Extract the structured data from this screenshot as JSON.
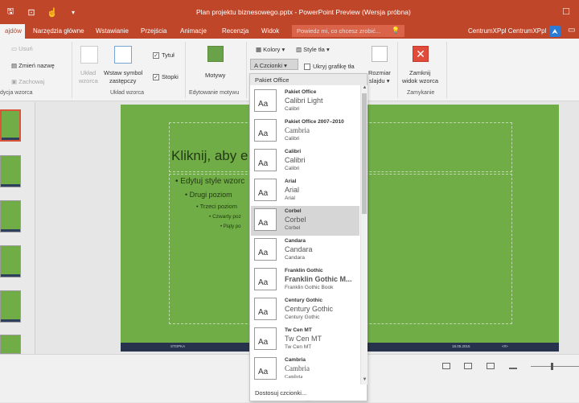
{
  "titlebar": {
    "title": "Plan projektu biznesowego.pptx - PowerPoint Preview (Wersja próbna)",
    "qat_icons": [
      "save-icon",
      "present-from-start-icon",
      "touch-mode-icon",
      "customize-qat-icon"
    ],
    "window_controls": "□"
  },
  "tabs": [
    {
      "label": "ajdów",
      "active": true
    },
    {
      "label": "Narzędzia główne"
    },
    {
      "label": "Wstawianie"
    },
    {
      "label": "Przejścia"
    },
    {
      "label": "Animacje"
    },
    {
      "label": "Recenzja"
    },
    {
      "label": "Widok"
    }
  ],
  "tellme": {
    "placeholder": "Powiedz mi, co chcesz zrobić..."
  },
  "user": {
    "name": "CentrumXPpl CentrumXPpl"
  },
  "ribbon": {
    "usun": "Usuń",
    "zmien_nazwe": "Zmień nazwę",
    "zachowaj": "Zachowaj",
    "edycja_wzorca": "dycja wzorca",
    "uklad_wzorca_btn": [
      "Układ",
      "wzorca"
    ],
    "wstaw_symbol": [
      "Wstaw symbol",
      "zastępczy"
    ],
    "tytul": "Tytuł",
    "stopki": "Stopki",
    "uklad_wzorca_group": "Układ wzorca",
    "motywy": "Motywy",
    "edytowanie_motywu": "Edytowanie motywu",
    "kolory": "Kolory",
    "czcionki": "Czcionki",
    "style_tla": "Style tła",
    "ukryj_grafike": "Ukryj grafikę tła",
    "rozmiar_slajdu": [
      "Rozmiar",
      "slajdu"
    ],
    "zamknij": [
      "Zamknij",
      "widok wzorca"
    ],
    "zamykanie": "Zamykanie",
    "accent_close": "#e04b3a"
  },
  "slide": {
    "title": "Kliknij, aby e",
    "levels": [
      "Edytuj style wzorc",
      "Drugi poziom",
      "Trzeci poziom",
      "Czwarty poz",
      "Piąty po"
    ],
    "footer_left": "STOPKA",
    "footer_date": "18.05.2015",
    "footer_num": "<#>",
    "bg_color": "#70ad47"
  },
  "fonts_dropdown": {
    "header": "Pakiet Office",
    "sample": "Aa",
    "items": [
      {
        "name": "Pakiet Office",
        "heading": "Calibri Light",
        "body": "Calibri"
      },
      {
        "name": "Pakiet Office 2007–2010",
        "heading": "Cambria",
        "body": "Calibri"
      },
      {
        "name": "Calibri",
        "heading": "Calibri",
        "body": "Calibri"
      },
      {
        "name": "Arial",
        "heading": "Arial",
        "body": "Arial"
      },
      {
        "name": "Corbel",
        "heading": "Corbel",
        "body": "Corbel",
        "highlighted": true
      },
      {
        "name": "Candara",
        "heading": "Candara",
        "body": "Candara"
      },
      {
        "name": "Franklin Gothic",
        "heading": "Franklin Gothic M...",
        "body": "Franklin Gothic Book"
      },
      {
        "name": "Century Gothic",
        "heading": "Century Gothic",
        "body": "Century Gothic"
      },
      {
        "name": "Tw Cen MT",
        "heading": "Tw Cen MT",
        "body": "Tw Cen MT"
      },
      {
        "name": "Cambria",
        "heading": "Cambria",
        "body": "Cambria"
      }
    ],
    "customize": "Dostosuj czcionki...",
    "grip": "....."
  }
}
